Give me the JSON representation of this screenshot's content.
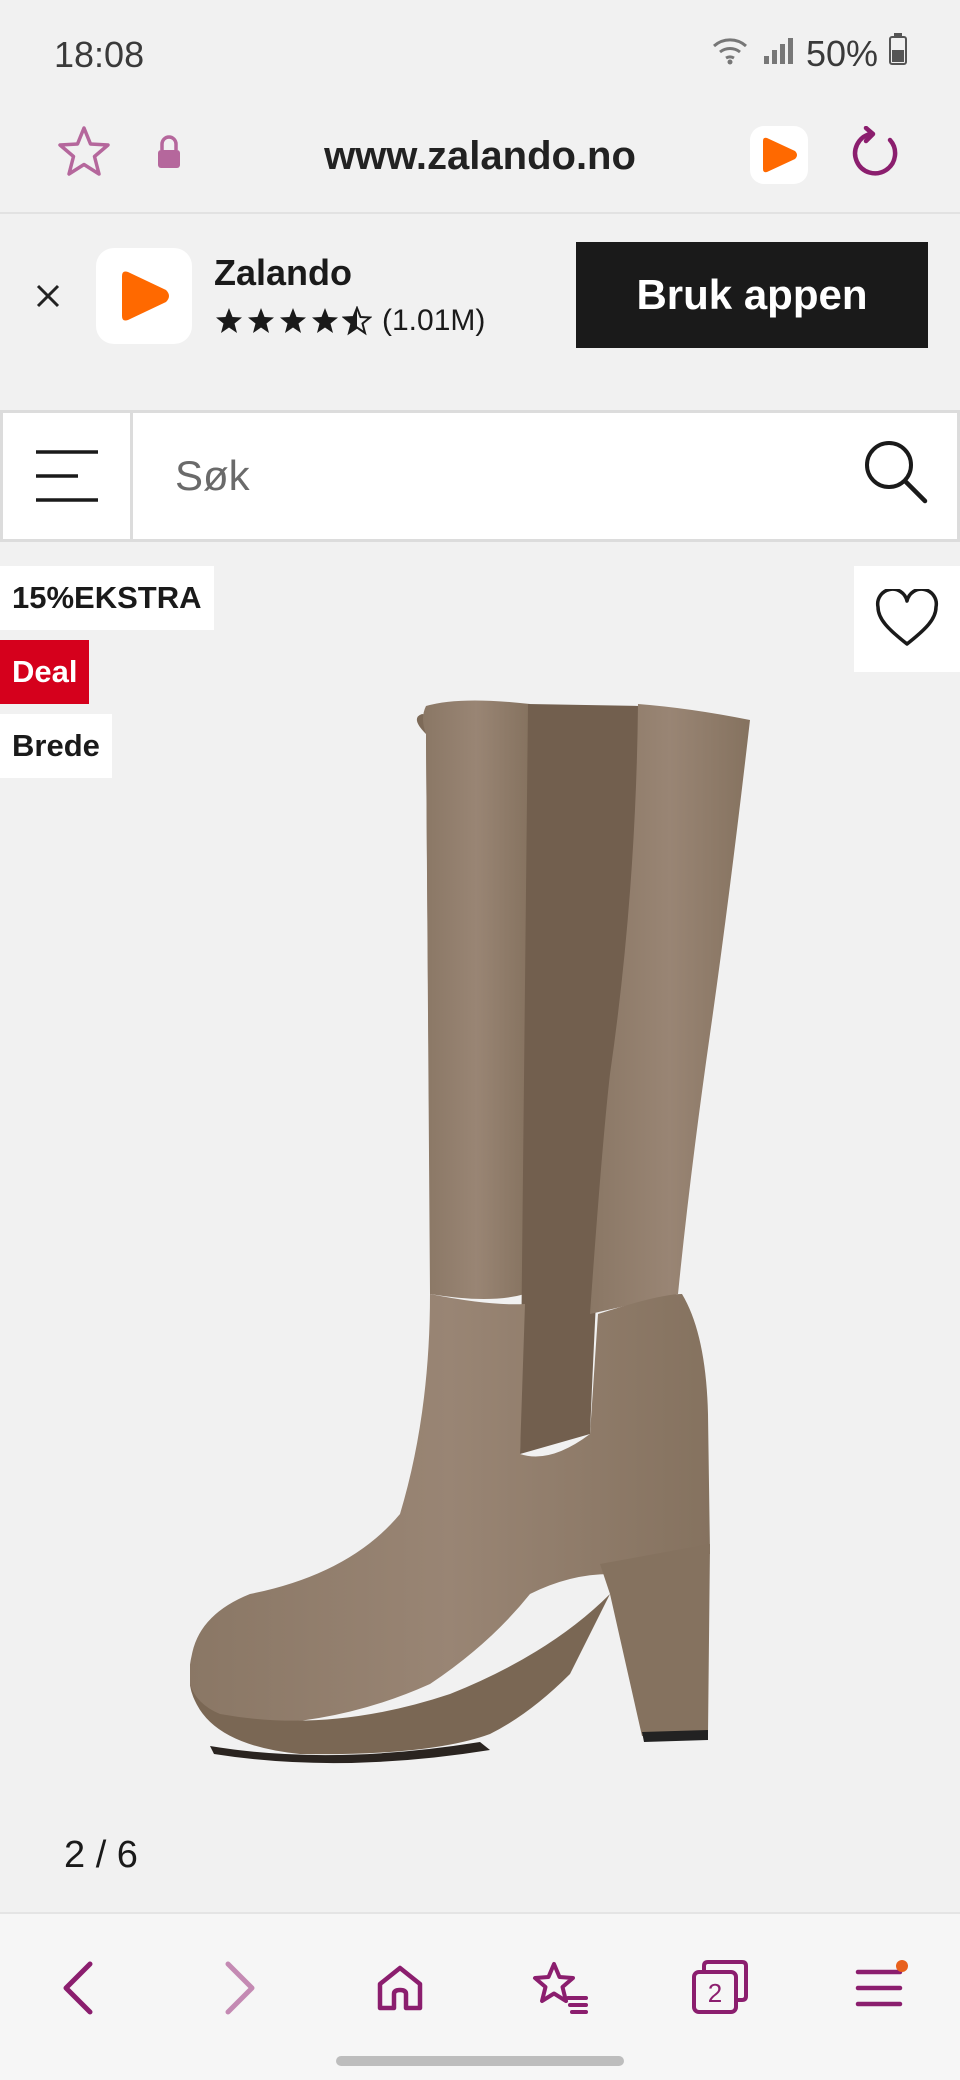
{
  "status_bar": {
    "time": "18:08",
    "battery": "50%"
  },
  "browser": {
    "url": "www.zalando.no",
    "tab_count": "2",
    "accent_color": "#8b1e6e"
  },
  "app_banner": {
    "app_name": "Zalando",
    "rating_count": "(1.01M)",
    "rating_stars": 4.5,
    "cta_label": "Bruk appen",
    "brand_color": "#ff6900"
  },
  "search": {
    "placeholder": "Søk"
  },
  "product": {
    "badges": {
      "extra": "15%EKSTRA",
      "deal": "Deal",
      "width": "Brede"
    },
    "deal_color": "#d5001c",
    "image_pager": "2 / 6"
  },
  "icons": {
    "favorite": "star-outline-icon",
    "lock": "lock-icon",
    "reload": "reload-icon",
    "close": "close-icon",
    "menu": "hamburger-icon",
    "search": "search-icon",
    "wishlist": "heart-icon",
    "back": "chevron-left-icon",
    "forward": "chevron-right-icon",
    "home": "home-icon",
    "bookmarks": "star-list-icon",
    "tabs": "tabs-icon",
    "browser_menu": "hamburger-icon"
  }
}
